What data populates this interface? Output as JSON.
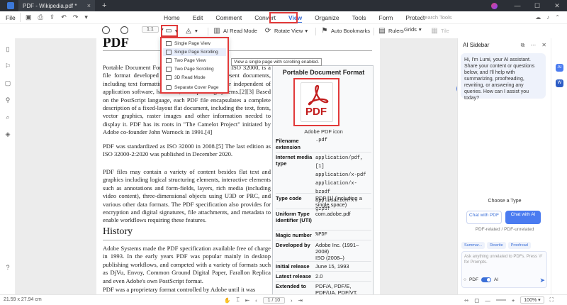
{
  "titlebar": {
    "tab_title": "PDF - Wikipedia.pdf *",
    "tab_close": "×",
    "tab_add": "+",
    "win_min": "—",
    "win_max": "☐",
    "win_close": "✕"
  },
  "menubar": {
    "file": "File",
    "tabs": [
      "Home",
      "Edit",
      "Comment",
      "Convert",
      "View",
      "Organize",
      "Tools",
      "Form",
      "Protect"
    ],
    "active_tab": "View",
    "search_tools": "Search Tools"
  },
  "toolbar": {
    "fit_label": "1:1",
    "ai_read_mode": "AI Read Mode",
    "rotate_view": "Rotate View",
    "auto_bookmarks": "Auto Bookmarks",
    "rulers": "Rulers",
    "grids": "Grids",
    "tile": "Tile"
  },
  "dropdown": {
    "items": [
      "Single Page View",
      "Single Page Scrolling",
      "Two Page View",
      "Two Page Scrolling",
      "3D Read Mode",
      "Separate Cover Page"
    ],
    "hovered_index": 1,
    "tooltip": "View a single page with scrolling enabled."
  },
  "document": {
    "title": "PDF",
    "para1": "Portable Document Format (PDF), standardized as ISO 32000, is a file format developed by Adobe in 1992 to present documents, including text formatting and images, in a manner independent of application software, hardware, and operating systems.[2][3] Based on the PostScript language, each PDF file encapsulates a complete description of a fixed-layout flat document, including the text, fonts, vector graphics, raster images and other information needed to display it. PDF has its roots in \"The Camelot Project\" initiated by Adobe co-founder John Warnock in 1991.[4]",
    "para2": "PDF was standardized as ISO 32000 in 2008.[5] The last edition as ISO 32000-2:2020 was published in December 2020.",
    "para3": "PDF files may contain a variety of content besides flat text and graphics including logical structuring elements, interactive elements such as annotations and form-fields, layers, rich media (including video content), three-dimensional objects using U3D or PRC, and various other data formats. The PDF specification also provides for encryption and digital signatures, file attachments, and metadata to enable workflows requiring these features.",
    "history_heading": "History",
    "para4": "Adobe Systems made the PDF specification available free of charge in 1993. In the early years PDF was popular mainly in desktop publishing workflows, and competed with a variety of formats such as DjVu, Envoy, Common Ground Digital Paper, Farallon Replica and even Adobe's own PostScript format.",
    "para5": "PDF was a proprietary format controlled by Adobe until it was"
  },
  "infobox": {
    "title": "Portable Document Format",
    "icon_text": "PDF",
    "caption": "Adobe PDF icon",
    "rows": [
      {
        "key": "Filename extension",
        "val": ".pdf"
      },
      {
        "key": "Internet media type",
        "val": "application/pdf,[1]\napplication/x-pdf\napplication/x-bzpdf\napplication/x-gzpdf"
      },
      {
        "key": "Type code",
        "val": "PDF  [1] (including a single space)"
      },
      {
        "key": "Uniform Type Identifier (UTI)",
        "val": "com.adobe.pdf"
      },
      {
        "key": "Magic number",
        "val": "%PDF"
      },
      {
        "key": "Developed by",
        "val": "Adobe Inc. (1991–2008)\nISO (2008–)"
      },
      {
        "key": "Initial release",
        "val": "June 15, 1993"
      },
      {
        "key": "Latest release",
        "val": "2.0"
      },
      {
        "key": "Extended to",
        "val": "PDF/A, PDF/E, PDF/UA, PDF/VT,"
      }
    ]
  },
  "ai_sidebar": {
    "title": "AI Sidebar",
    "greeting": "Hi, I'm Lumi, your AI assistant. Share your content or questions below, and I'll help with summarizing, proofreading, rewriting, or answering any queries. How can I assist you today?",
    "choose_type": "Choose a Type",
    "chat_pdf": "Chat with PDF",
    "chat_ai": "Chat with AI",
    "hint": "PDF-related / PDF-unrelated",
    "chips": [
      "Summar...",
      "Rewrite",
      "Proofread"
    ],
    "input_placeholder": "Ask anything unrelated to PDFs. Press '#' for Prompts.",
    "opt_pdf": "PDF",
    "opt_ai": "AI"
  },
  "statusbar": {
    "page_size": "21.59 x 27.94 cm",
    "page_indicator": "1 / 10",
    "zoom": "100%"
  },
  "colors": {
    "accent": "#3b6fd8",
    "highlight_red": "#e23a3a",
    "pdf_red": "#c21d1d"
  }
}
